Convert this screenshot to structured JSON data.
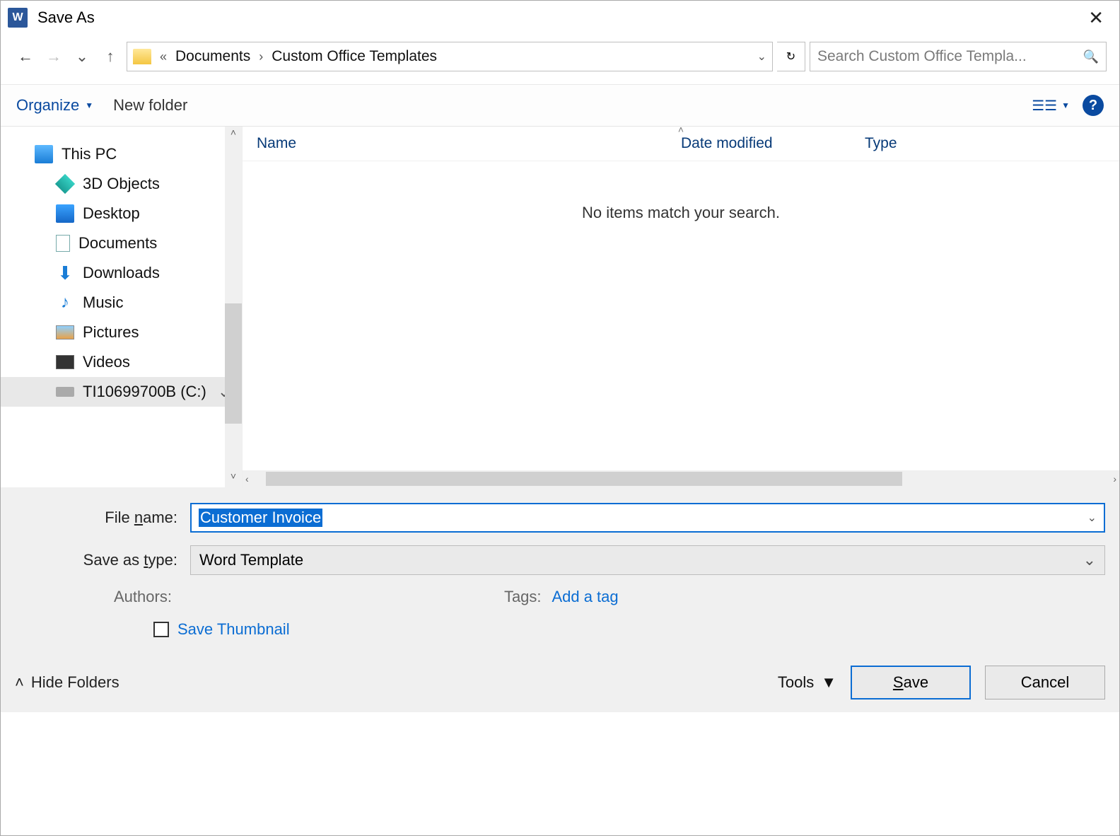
{
  "window": {
    "title": "Save As"
  },
  "nav": {
    "back": "←",
    "forward": "→",
    "dropdown": "⌄",
    "up": "↑"
  },
  "breadcrumb": {
    "prefix": "«",
    "seg1": "Documents",
    "sep": "›",
    "seg2": "Custom Office Templates",
    "expand": "⌄"
  },
  "refresh": "↻",
  "search": {
    "placeholder": "Search Custom Office Templa..."
  },
  "toolbar": {
    "organize": "Organize",
    "newfolder": "New folder",
    "viewtri": "▼",
    "help": "?"
  },
  "tree": {
    "thispc": "This PC",
    "threed": "3D Objects",
    "desktop": "Desktop",
    "documents": "Documents",
    "downloads": "Downloads",
    "music": "Music",
    "pictures": "Pictures",
    "videos": "Videos",
    "drive": "TI10699700B (C:)"
  },
  "columns": {
    "name": "Name",
    "date": "Date modified",
    "type": "Type"
  },
  "empty_msg": "No items match your search.",
  "form": {
    "filename_label_pre": "File ",
    "filename_label_ul": "n",
    "filename_label_post": "ame:",
    "filename_value": "Customer Invoice",
    "type_label_pre": "Save as ",
    "type_label_ul": "t",
    "type_label_post": "ype:",
    "type_value": "Word Template",
    "authors_label": "Authors:",
    "tags_label": "Tags:",
    "tags_link": "Add a tag",
    "thumb_label": "Save Thumbnail"
  },
  "footer": {
    "hide": "Hide Folders",
    "tools": "Tools",
    "save_ul": "S",
    "save_post": "ave",
    "cancel": "Cancel"
  }
}
